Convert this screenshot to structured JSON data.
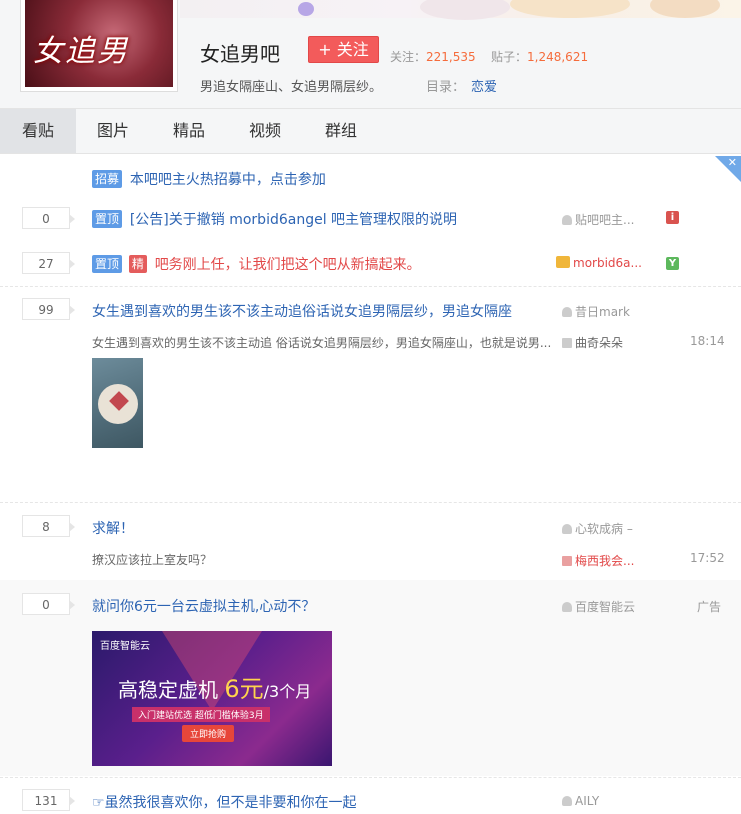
{
  "header": {
    "forum_title": "女追男吧",
    "avatar_text": "女追男",
    "follow_label": "+ 关注",
    "followers_label": "关注：",
    "followers_value": "221,535",
    "posts_label": "贴子：",
    "posts_value": "1,248,621",
    "slogan": "男追女隔座山、女追男隔层纱。",
    "catalog_label": "目录：",
    "catalog_value": "恋爱"
  },
  "nav": {
    "tabs": [
      {
        "label": "看贴"
      },
      {
        "label": "图片"
      },
      {
        "label": "精品"
      },
      {
        "label": "视频"
      },
      {
        "label": "群组"
      }
    ]
  },
  "notice": {
    "tag": "招募",
    "text": "本吧吧主火热招募中，点击参加",
    "close": "✕"
  },
  "threads": [
    {
      "replies": "0",
      "tags": [
        "置顶"
      ],
      "title": "[公告]关于撤销 morbid6angel 吧主管理权限的说明",
      "author": "贴吧吧主..."
    },
    {
      "replies": "27",
      "tags": [
        "置顶",
        "精"
      ],
      "title": "吧务刚上任，让我们把这个吧从新搞起来。",
      "author": "morbid6a..."
    },
    {
      "replies": "99",
      "title": "女生遇到喜欢的男生该不该主动追俗话说女追男隔层纱，男追女隔座",
      "excerpt": "女生遇到喜欢的男生该不该主动追 俗话说女追男隔层纱，男追女隔座山，也就是说男...",
      "author": "昔日mark",
      "last_reply": "曲奇朵朵",
      "time": "18:14"
    },
    {
      "replies": "8",
      "title": "求解！",
      "excerpt": "撩汉应该拉上室友吗？",
      "author": "心软成病 –",
      "last_reply": "梅西我会...",
      "time": "17:52"
    },
    {
      "replies": "0",
      "title": "就问你6元一台云虚拟主机,心动不？",
      "author": "百度智能云",
      "ad_label": "广告",
      "ad": {
        "brand": "百度智能云",
        "headline_a": "高稳定虚机",
        "headline_b": "6元",
        "headline_c": "/3个月",
        "subline": "入门建站优选  超低门槛体验3月",
        "button": "立即抢购"
      }
    },
    {
      "replies": "131",
      "title": "虽然我很喜欢你，但不是非要和你在一起",
      "author": "AILY"
    }
  ]
}
